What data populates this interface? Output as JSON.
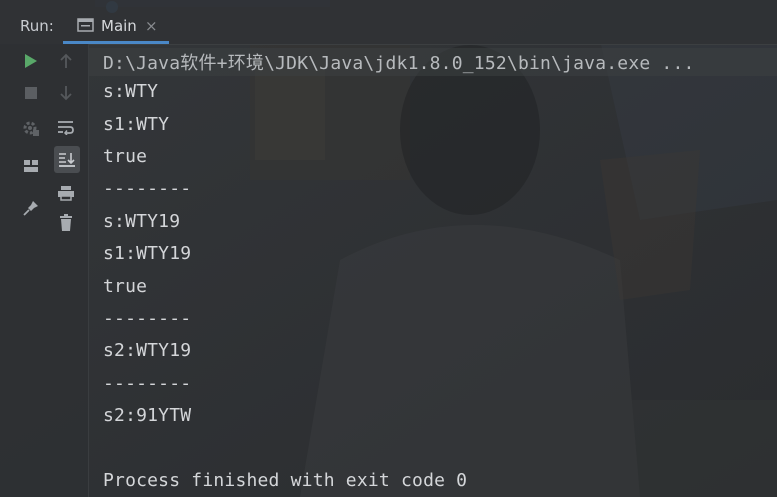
{
  "run_panel": {
    "label": "Run:",
    "tab_label": "Main",
    "tab_close": "×"
  },
  "console": {
    "lines": [
      "D:\\Java软件+环境\\JDK\\Java\\jdk1.8.0_152\\bin\\java.exe ...",
      "s:WTY",
      "s1:WTY",
      "true",
      "--------",
      "s:WTY19",
      "s1:WTY19",
      "true",
      "--------",
      "s2:WTY19",
      "--------",
      "s2:91YTW",
      "",
      "Process finished with exit code 0"
    ]
  },
  "colors": {
    "accent": "#4a88c7",
    "run_green": "#59a869",
    "text": "#d4d6d9"
  },
  "icons": [
    "run-icon",
    "stop-icon",
    "settings-icon",
    "layout-icon",
    "pin-icon",
    "up-arrow-icon",
    "down-arrow-icon",
    "soft-wrap-icon",
    "scroll-to-end-icon",
    "print-icon",
    "trash-icon"
  ]
}
